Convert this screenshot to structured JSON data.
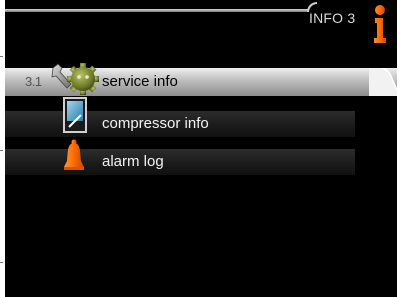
{
  "header": {
    "title": "INFO 3",
    "icon": "info-icon",
    "accent_color": "#ff6a00"
  },
  "menu": {
    "items": [
      {
        "number": "3.1",
        "label": "service info",
        "icon": "wrench-gear-icon",
        "selected": true
      },
      {
        "number": "",
        "label": "compressor info",
        "icon": "compressor-icon",
        "selected": false
      },
      {
        "number": "",
        "label": "alarm log",
        "icon": "bell-icon",
        "selected": false
      }
    ]
  },
  "colors": {
    "screen_bg": "#000000",
    "selected_row": "#c0c0c0",
    "accent": "#ff6a00"
  }
}
